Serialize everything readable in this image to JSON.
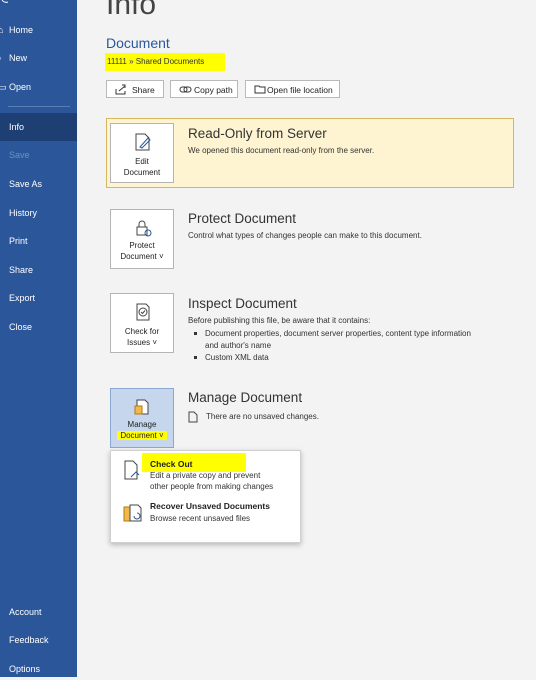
{
  "sidebar": {
    "items": [
      {
        "label": "Home",
        "icon": "house-icon"
      },
      {
        "label": "New",
        "icon": "new-doc-icon"
      },
      {
        "label": "Open",
        "icon": "folder-icon"
      },
      {
        "label": "Info"
      },
      {
        "label": "Save"
      },
      {
        "label": "Save As"
      },
      {
        "label": "History"
      },
      {
        "label": "Print"
      },
      {
        "label": "Share"
      },
      {
        "label": "Export"
      },
      {
        "label": "Close"
      }
    ],
    "bottom": [
      {
        "label": "Account"
      },
      {
        "label": "Feedback"
      },
      {
        "label": "Options"
      }
    ],
    "back_icon": "back-arrow-icon"
  },
  "page": {
    "title": "Info",
    "doc_name": "Document",
    "doc_path": "11111 » Shared Documents"
  },
  "actions": {
    "share": "Share",
    "copy_path": "Copy path",
    "open_location": "Open file location"
  },
  "readonly": {
    "tile_line1": "Edit",
    "tile_line2": "Document",
    "title": "Read-Only from Server",
    "desc": "We opened this document read-only from the server."
  },
  "protect": {
    "tile_line1": "Protect",
    "tile_line2": "Document ˅",
    "title": "Protect Document",
    "desc": "Control what types of changes people can make to this document."
  },
  "inspect": {
    "tile_line1": "Check for",
    "tile_line2": "Issues ˅",
    "title": "Inspect Document",
    "desc": "Before publishing this file, be aware that it contains:",
    "bullets": [
      "Document properties, document server properties, content type information",
      "and author's name",
      "Custom XML data"
    ]
  },
  "manage": {
    "tile_line1": "Manage",
    "tile_line2": "Document ˅",
    "title": "Manage Document",
    "desc": "There are no unsaved changes."
  },
  "dropdown": {
    "checkout_title": "Check Out",
    "checkout_desc1": "Edit a private copy and prevent",
    "checkout_desc2": "other people from making changes",
    "recover_title": "Recover Unsaved Documents",
    "recover_desc": "Browse recent unsaved files"
  },
  "colors": {
    "sidebar": "#2b579a",
    "sidebar_active": "#1e3f73",
    "highlight": "#ffff00",
    "banner": "#fff4d1"
  }
}
